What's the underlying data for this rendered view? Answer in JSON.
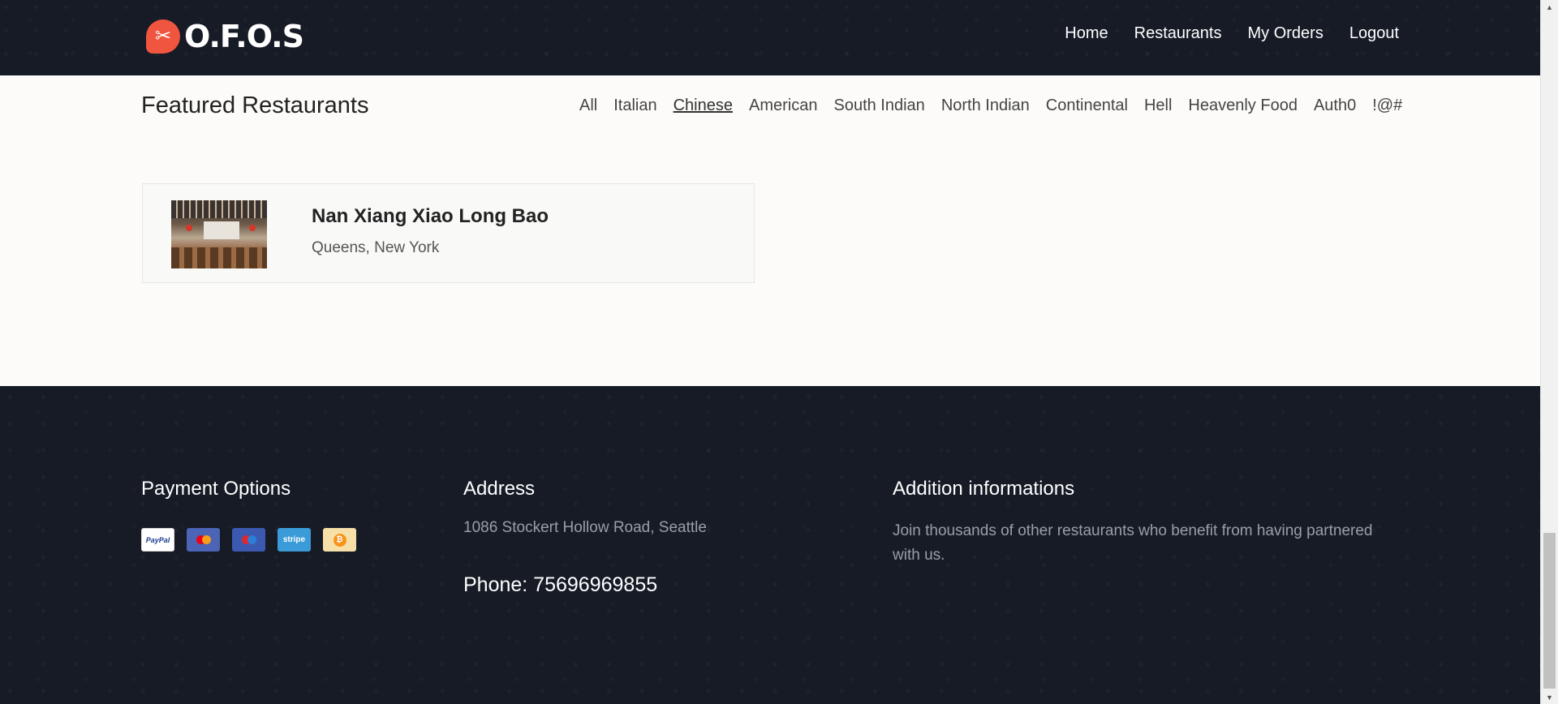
{
  "header": {
    "logo_text": "O.F.O.S",
    "logo_icon": "utensils-icon",
    "nav": [
      {
        "label": "Home"
      },
      {
        "label": "Restaurants"
      },
      {
        "label": "My Orders"
      },
      {
        "label": "Logout"
      }
    ]
  },
  "main": {
    "section_title": "Featured Restaurants",
    "filters": [
      {
        "label": "All",
        "active": false
      },
      {
        "label": "Italian",
        "active": false
      },
      {
        "label": "Chinese",
        "active": true
      },
      {
        "label": "American",
        "active": false
      },
      {
        "label": "South Indian",
        "active": false
      },
      {
        "label": "North Indian",
        "active": false
      },
      {
        "label": "Continental",
        "active": false
      },
      {
        "label": "Hell",
        "active": false
      },
      {
        "label": "Heavenly Food",
        "active": false
      },
      {
        "label": "Auth0",
        "active": false
      },
      {
        "label": "!@#",
        "active": false
      }
    ],
    "restaurants": [
      {
        "name": "Nan Xiang Xiao Long Bao",
        "location": "Queens, New York"
      }
    ]
  },
  "footer": {
    "payment": {
      "title": "Payment Options",
      "methods": [
        {
          "name": "paypal",
          "label": "PayPal"
        },
        {
          "name": "mastercard",
          "label": ""
        },
        {
          "name": "maestro",
          "label": ""
        },
        {
          "name": "stripe",
          "label": "stripe"
        },
        {
          "name": "bitcoin",
          "label": ""
        }
      ]
    },
    "address": {
      "title": "Address",
      "text": "1086 Stockert Hollow Road, Seattle",
      "phone": "Phone: 75696969855"
    },
    "info": {
      "title": "Addition informations",
      "text": "Join thousands of other restaurants who benefit from having partnered with us."
    }
  },
  "colors": {
    "header_bg": "#161b26",
    "accent": "#f0553f",
    "page_bg": "#fcfbf9"
  }
}
